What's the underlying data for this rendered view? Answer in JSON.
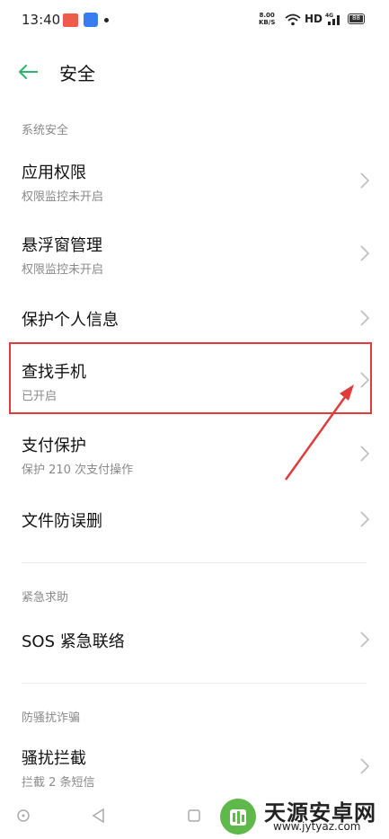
{
  "status_bar": {
    "time": "13:40",
    "net_speed_value": "8.00",
    "net_speed_unit": "KB/S",
    "hd": "HD",
    "signal_label": "4G",
    "battery": "88"
  },
  "header": {
    "title": "安全",
    "back_icon": "back-arrow-icon"
  },
  "sections": [
    {
      "label": "系统安全"
    },
    {
      "label": "紧急求助"
    },
    {
      "label": "防骚扰诈骗"
    }
  ],
  "items": [
    {
      "title": "应用权限",
      "subtitle": "权限监控未开启"
    },
    {
      "title": "悬浮窗管理",
      "subtitle": "权限监控未开启"
    },
    {
      "title": "保护个人信息"
    },
    {
      "title": "查找手机",
      "subtitle": "已开启"
    },
    {
      "title": "支付保护",
      "subtitle": "保护 210 次支付操作"
    },
    {
      "title": "文件防误删"
    },
    {
      "title": "SOS 紧急联络"
    },
    {
      "title": "骚扰拦截",
      "subtitle": "拦截 2 条短信"
    }
  ],
  "annotation": {
    "highlight_color": "#e23b3b",
    "target": "查找手机"
  },
  "watermark": {
    "title": "天源安卓网",
    "url": "www.jytyaz.com"
  },
  "colors": {
    "accent_green": "#2fb36d",
    "secondary_text": "#8a8a8a"
  }
}
